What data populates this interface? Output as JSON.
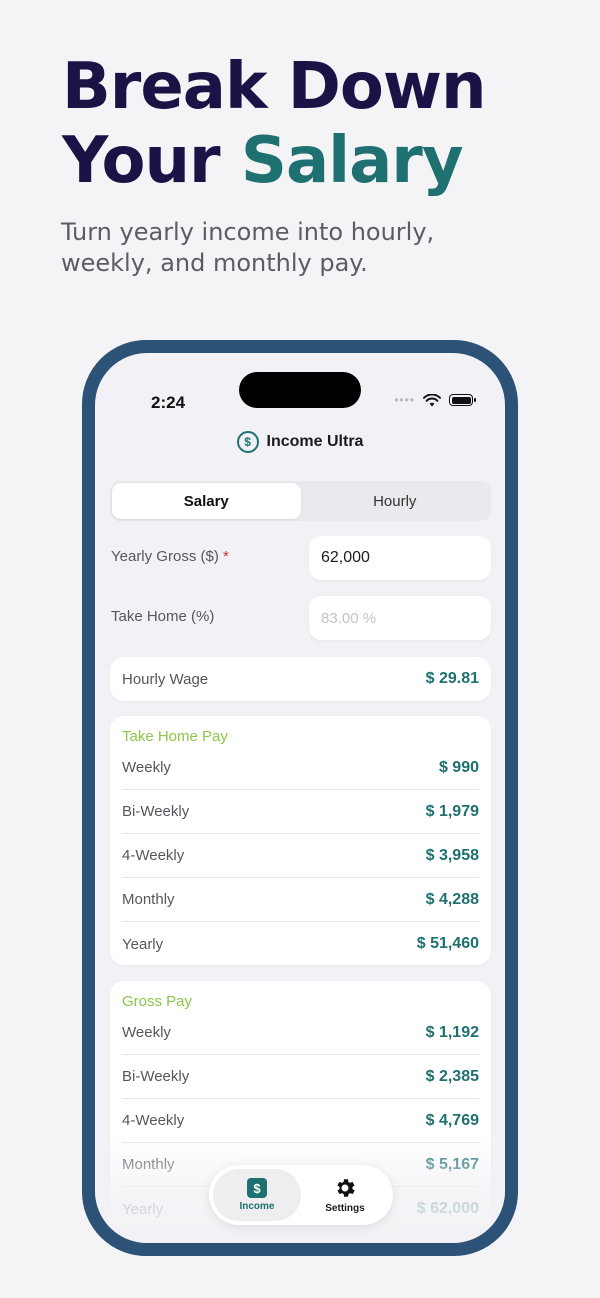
{
  "hero": {
    "line1": "Break Down",
    "line2_plain": "Your ",
    "line2_accent": "Salary",
    "subtitle": "Turn yearly income into hourly, weekly, and monthly pay."
  },
  "status_bar": {
    "time": "2:24"
  },
  "app": {
    "title": "Income Ultra"
  },
  "mode_tabs": [
    {
      "label": "Salary",
      "selected": true
    },
    {
      "label": "Hourly",
      "selected": false
    }
  ],
  "inputs": {
    "yearly_gross": {
      "label": "Yearly Gross ($)",
      "required_mark": "*",
      "value": "62,000"
    },
    "take_home": {
      "label": "Take Home (%)",
      "placeholder": "83.00 %"
    }
  },
  "hourly_wage": {
    "label": "Hourly Wage",
    "value": "$ 29.81"
  },
  "take_home_pay": {
    "title": "Take Home Pay",
    "rows": [
      {
        "label": "Weekly",
        "value": "$ 990"
      },
      {
        "label": "Bi-Weekly",
        "value": "$ 1,979"
      },
      {
        "label": "4-Weekly",
        "value": "$ 3,958"
      },
      {
        "label": "Monthly",
        "value": "$ 4,288"
      },
      {
        "label": "Yearly",
        "value": "$ 51,460"
      }
    ]
  },
  "gross_pay": {
    "title": "Gross Pay",
    "rows": [
      {
        "label": "Weekly",
        "value": "$ 1,192"
      },
      {
        "label": "Bi-Weekly",
        "value": "$ 2,385"
      },
      {
        "label": "4-Weekly",
        "value": "$ 4,769"
      },
      {
        "label": "Monthly",
        "value": "$ 5,167"
      },
      {
        "label": "Yearly",
        "value": "$ 62,000"
      }
    ]
  },
  "tab_bar": [
    {
      "label": "Income",
      "icon": "dollar-icon",
      "active": true
    },
    {
      "label": "Settings",
      "icon": "gear-icon",
      "active": false
    }
  ],
  "colors": {
    "headline": "#1a1446",
    "accent": "#1f7070",
    "section_title": "#8cc64a",
    "phone_frame": "#2d5277",
    "required": "#d0303a"
  }
}
